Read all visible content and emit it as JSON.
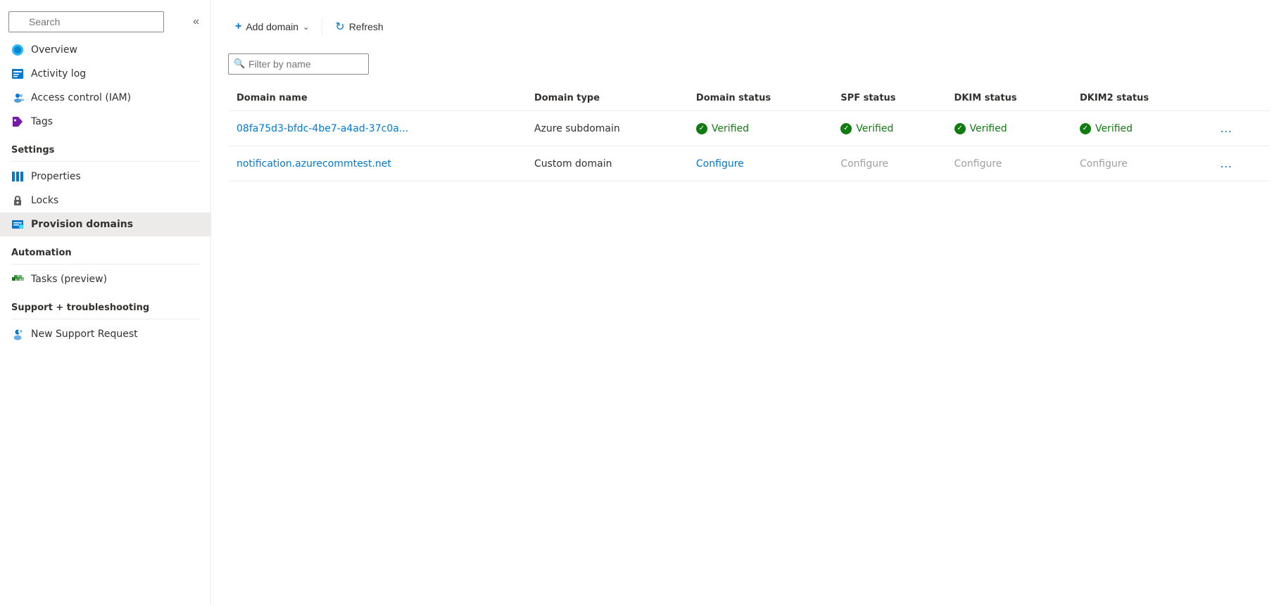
{
  "sidebar": {
    "search_placeholder": "Search",
    "items_top": [
      {
        "id": "overview",
        "label": "Overview",
        "icon": "overview-icon"
      },
      {
        "id": "activity-log",
        "label": "Activity log",
        "icon": "activity-icon"
      },
      {
        "id": "access-control",
        "label": "Access control (IAM)",
        "icon": "iam-icon"
      },
      {
        "id": "tags",
        "label": "Tags",
        "icon": "tags-icon"
      }
    ],
    "sections": [
      {
        "title": "Settings",
        "items": [
          {
            "id": "properties",
            "label": "Properties",
            "icon": "properties-icon"
          },
          {
            "id": "locks",
            "label": "Locks",
            "icon": "locks-icon"
          },
          {
            "id": "provision-domains",
            "label": "Provision domains",
            "icon": "provision-icon",
            "active": true
          }
        ]
      },
      {
        "title": "Automation",
        "items": [
          {
            "id": "tasks-preview",
            "label": "Tasks (preview)",
            "icon": "tasks-icon"
          }
        ]
      },
      {
        "title": "Support + troubleshooting",
        "items": [
          {
            "id": "new-support",
            "label": "New Support Request",
            "icon": "support-icon"
          }
        ]
      }
    ]
  },
  "toolbar": {
    "add_domain_label": "Add domain",
    "add_domain_dropdown": true,
    "refresh_label": "Refresh"
  },
  "filter": {
    "placeholder": "Filter by name"
  },
  "table": {
    "columns": [
      "Domain name",
      "Domain type",
      "Domain status",
      "SPF status",
      "DKIM status",
      "DKIM2 status"
    ],
    "rows": [
      {
        "domain_name": "08fa75d3-bfdc-4be7-a4ad-37c0a...",
        "domain_type": "Azure subdomain",
        "domain_status": "Verified",
        "domain_status_type": "verified",
        "spf_status": "Verified",
        "spf_status_type": "verified",
        "dkim_status": "Verified",
        "dkim_status_type": "verified",
        "dkim2_status": "Verified",
        "dkim2_status_type": "verified"
      },
      {
        "domain_name": "notification.azurecommtest.net",
        "domain_type": "Custom domain",
        "domain_status": "Configure",
        "domain_status_type": "configure-link",
        "spf_status": "Configure",
        "spf_status_type": "configure-gray",
        "dkim_status": "Configure",
        "dkim_status_type": "configure-gray",
        "dkim2_status": "Configure",
        "dkim2_status_type": "configure-gray"
      }
    ]
  }
}
